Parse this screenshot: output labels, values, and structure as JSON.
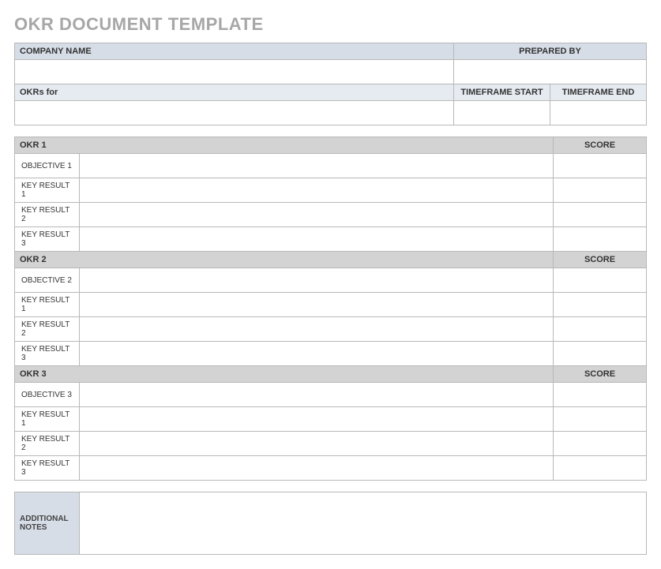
{
  "title": "OKR DOCUMENT TEMPLATE",
  "header": {
    "company_name_label": "COMPANY NAME",
    "prepared_by_label": "PREPARED BY",
    "company_name_value": "",
    "prepared_by_value": "",
    "okrs_for_label": "OKRs for",
    "timeframe_start_label": "TIMEFRAME START",
    "timeframe_end_label": "TIMEFRAME END",
    "okrs_for_value": "",
    "timeframe_start_value": "",
    "timeframe_end_value": ""
  },
  "okrs": [
    {
      "name": "OKR 1",
      "score_label": "SCORE",
      "score_value": "",
      "rows": [
        {
          "label": "OBJECTIVE 1",
          "value": "",
          "score": ""
        },
        {
          "label": "KEY RESULT 1",
          "value": "",
          "score": ""
        },
        {
          "label": "KEY RESULT 2",
          "value": "",
          "score": ""
        },
        {
          "label": "KEY RESULT 3",
          "value": "",
          "score": ""
        }
      ]
    },
    {
      "name": "OKR 2",
      "score_label": "SCORE",
      "score_value": "",
      "rows": [
        {
          "label": "OBJECTIVE 2",
          "value": "",
          "score": ""
        },
        {
          "label": "KEY RESULT 1",
          "value": "",
          "score": ""
        },
        {
          "label": "KEY RESULT 2",
          "value": "",
          "score": ""
        },
        {
          "label": "KEY RESULT 3",
          "value": "",
          "score": ""
        }
      ]
    },
    {
      "name": "OKR 3",
      "score_label": "SCORE",
      "score_value": "",
      "rows": [
        {
          "label": "OBJECTIVE 3",
          "value": "",
          "score": ""
        },
        {
          "label": "KEY RESULT 1",
          "value": "",
          "score": ""
        },
        {
          "label": "KEY RESULT 2",
          "value": "",
          "score": ""
        },
        {
          "label": "KEY RESULT 3",
          "value": "",
          "score": ""
        }
      ]
    }
  ],
  "notes": {
    "label": "ADDITIONAL NOTES",
    "value": ""
  }
}
